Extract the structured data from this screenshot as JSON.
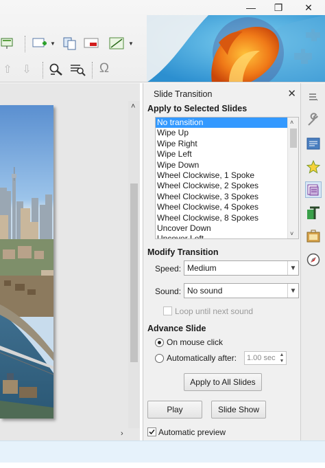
{
  "window": {
    "minimize_glyph": "—",
    "restore_glyph": "❐",
    "close_glyph": "✕"
  },
  "toolbar": {
    "icons": [
      "presentation-icon",
      "insert-icon",
      "copy-icon",
      "eraser-icon",
      "line-icon"
    ],
    "row2_icons": [
      "up-arrow-icon",
      "down-arrow-icon",
      "zoom-icon",
      "find-replace-icon",
      "special-character-icon"
    ],
    "omega_glyph": "Ω"
  },
  "panel": {
    "title": "Slide Transition",
    "close_glyph": "✕",
    "apply_heading": "Apply to Selected Slides",
    "transitions": [
      "No transition",
      "Wipe Up",
      "Wipe Right",
      "Wipe Left",
      "Wipe Down",
      "Wheel Clockwise, 1 Spoke",
      "Wheel Clockwise, 2 Spokes",
      "Wheel Clockwise, 3 Spokes",
      "Wheel Clockwise, 4 Spokes",
      "Wheel Clockwise, 8 Spokes",
      "Uncover Down",
      "Uncover Left"
    ],
    "selected_transition": "No transition",
    "modify_heading": "Modify Transition",
    "speed_label": "Speed:",
    "speed_value": "Medium",
    "sound_label": "Sound:",
    "sound_value": "No sound",
    "loop_label": "Loop until next sound",
    "advance_heading": "Advance Slide",
    "on_click_label": "On mouse click",
    "auto_label": "Automatically after:",
    "auto_value": "1.00 sec",
    "apply_all_label": "Apply to All Slides",
    "play_label": "Play",
    "slideshow_label": "Slide Show",
    "auto_preview_label": "Automatic preview",
    "auto_preview_checked": true
  },
  "sidebar": {
    "icons": [
      "menu-icon",
      "properties-icon",
      "master-slides-icon",
      "animation-icon",
      "transition-icon",
      "styles-icon",
      "gallery-icon",
      "navigator-icon"
    ]
  },
  "colors": {
    "selection": "#3399ff",
    "status_bar": "#e6f2fb"
  }
}
